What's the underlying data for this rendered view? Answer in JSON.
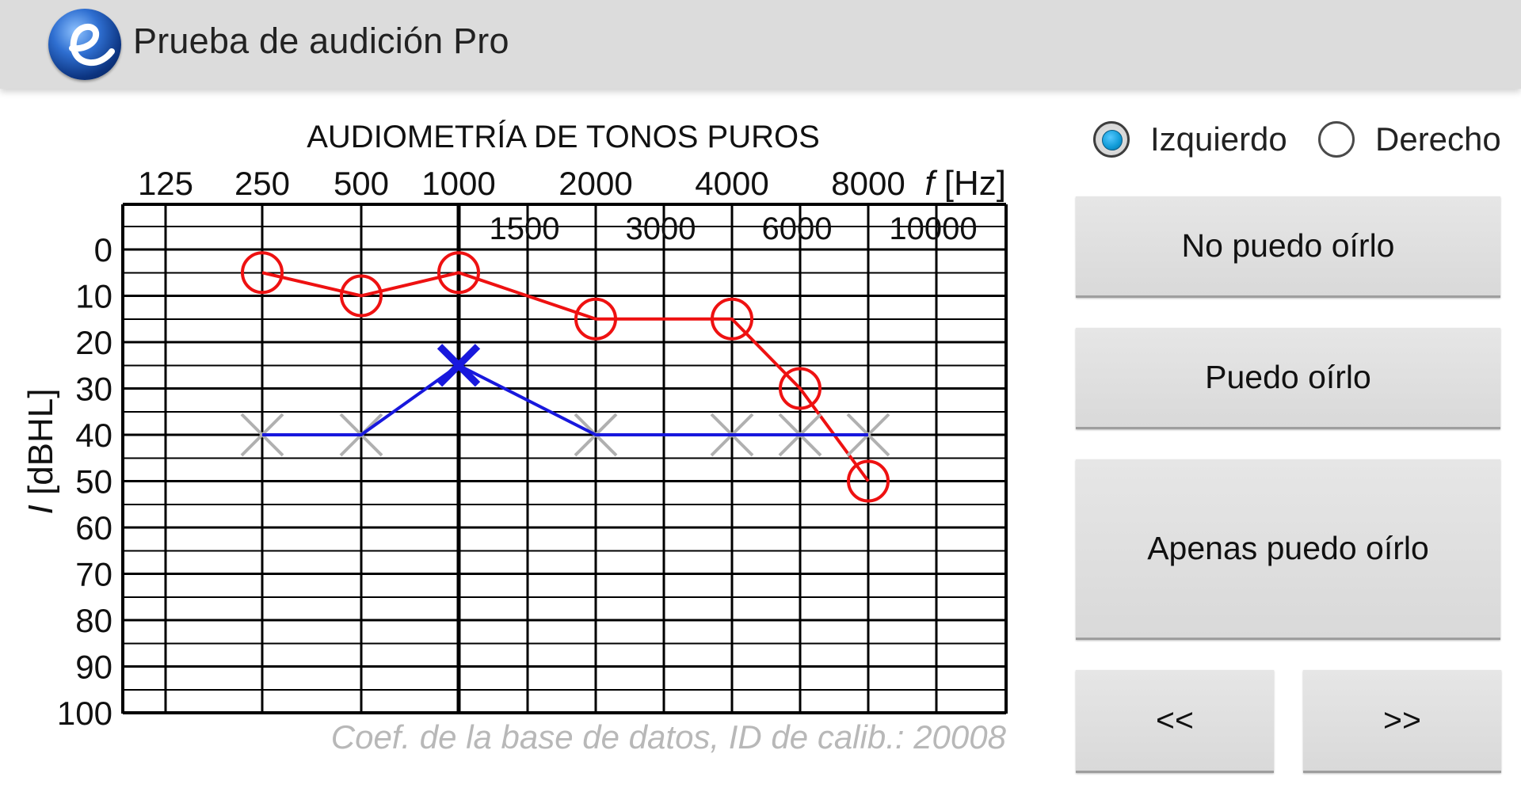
{
  "app": {
    "title": "Prueba de audición Pro"
  },
  "ear_selector": {
    "options": [
      {
        "label": "Izquierdo",
        "checked": true
      },
      {
        "label": "Derecho",
        "checked": false
      }
    ]
  },
  "buttons": {
    "cant_hear": "No puedo oírlo",
    "can_hear": "Puedo oírlo",
    "barely_hear": "Apenas puedo oírlo",
    "prev": "<<",
    "next": ">>"
  },
  "chart_data": {
    "type": "line",
    "title": "AUDIOMETRÍA DE TONOS PUROS",
    "xlabel_italic": "f",
    "xlabel_unit": "[Hz]",
    "ylabel_italic": "I",
    "ylabel_unit": "[dBHL]",
    "x_top_ticks": [
      "125",
      "250",
      "500",
      "1000",
      "2000",
      "4000",
      "8000"
    ],
    "x_sub_ticks": [
      "1500",
      "3000",
      "6000",
      "10000"
    ],
    "y_ticks": [
      "0",
      "10",
      "20",
      "30",
      "40",
      "50",
      "60",
      "70",
      "80",
      "90",
      "100"
    ],
    "ylim": [
      0,
      100
    ],
    "footer": "Coef. de la base de datos, ID de calib.: 20008",
    "series": [
      {
        "marker": "circle",
        "color": "#ee1111",
        "x": [
          250,
          500,
          1000,
          2000,
          4000,
          6000,
          8000
        ],
        "y": [
          5,
          10,
          5,
          15,
          15,
          30,
          50
        ]
      },
      {
        "marker": "cross",
        "color": "#1818dd",
        "x": [
          250,
          500,
          1000,
          2000,
          4000,
          6000,
          8000
        ],
        "y": [
          40,
          40,
          25,
          40,
          40,
          40,
          40
        ]
      }
    ],
    "current_point": {
      "x": 1000,
      "y": 25
    }
  }
}
